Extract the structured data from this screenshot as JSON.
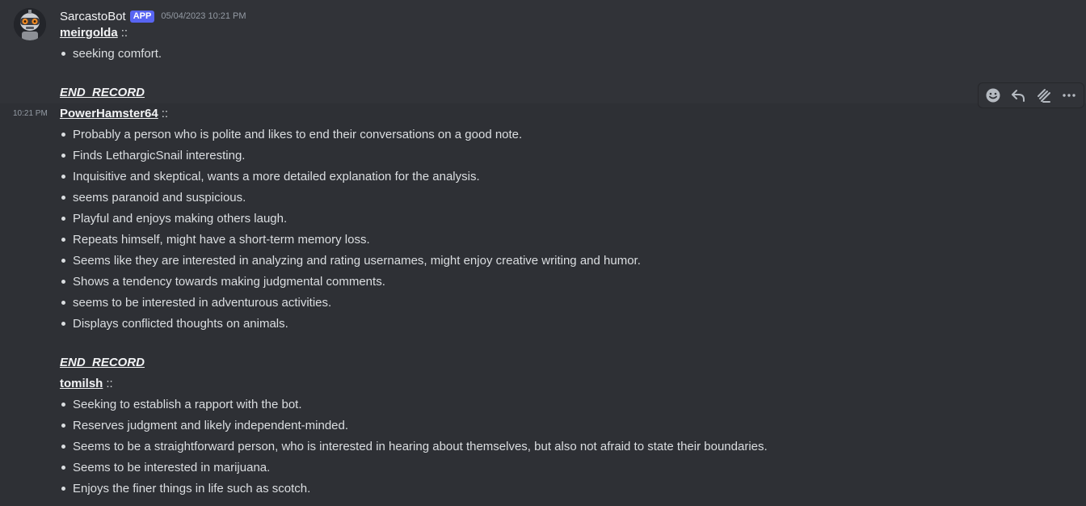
{
  "message": {
    "author": "SarcastoBot",
    "badge": "APP",
    "timestamp": "05/04/2023 10:21 PM",
    "side_time": "10:21 PM",
    "separator": "::",
    "end_record": "END_RECORD"
  },
  "records": [
    {
      "username": "meirgolda",
      "traits": [
        "seeking comfort."
      ]
    },
    {
      "username": "PowerHamster64",
      "traits": [
        "Probably a person who is polite and likes to end their conversations on a good note.",
        "Finds LethargicSnail interesting.",
        "Inquisitive and skeptical, wants a more detailed explanation for the analysis.",
        "seems paranoid and suspicious.",
        "Playful and enjoys making others laugh.",
        "Repeats himself, might have a short-term memory loss.",
        "Seems like they are interested in analyzing and rating usernames, might enjoy creative writing and humor.",
        "Shows a tendency towards making judgmental comments.",
        "seems to be interested in adventurous activities.",
        "Displays conflicted thoughts on animals."
      ]
    },
    {
      "username": "tomilsh",
      "traits": [
        "Seeking to establish a rapport with the bot.",
        "Reserves judgment and likely independent-minded.",
        "Seems to be a straightforward person, who is interested in hearing about themselves, but also not afraid to state their boundaries.",
        "Seems to be interested in marijuana.",
        "Enjoys the finer things in life such as scotch."
      ]
    }
  ],
  "toolbar": {
    "icons": [
      "add-reaction-icon",
      "reply-icon",
      "thread-icon",
      "more-icon"
    ]
  }
}
